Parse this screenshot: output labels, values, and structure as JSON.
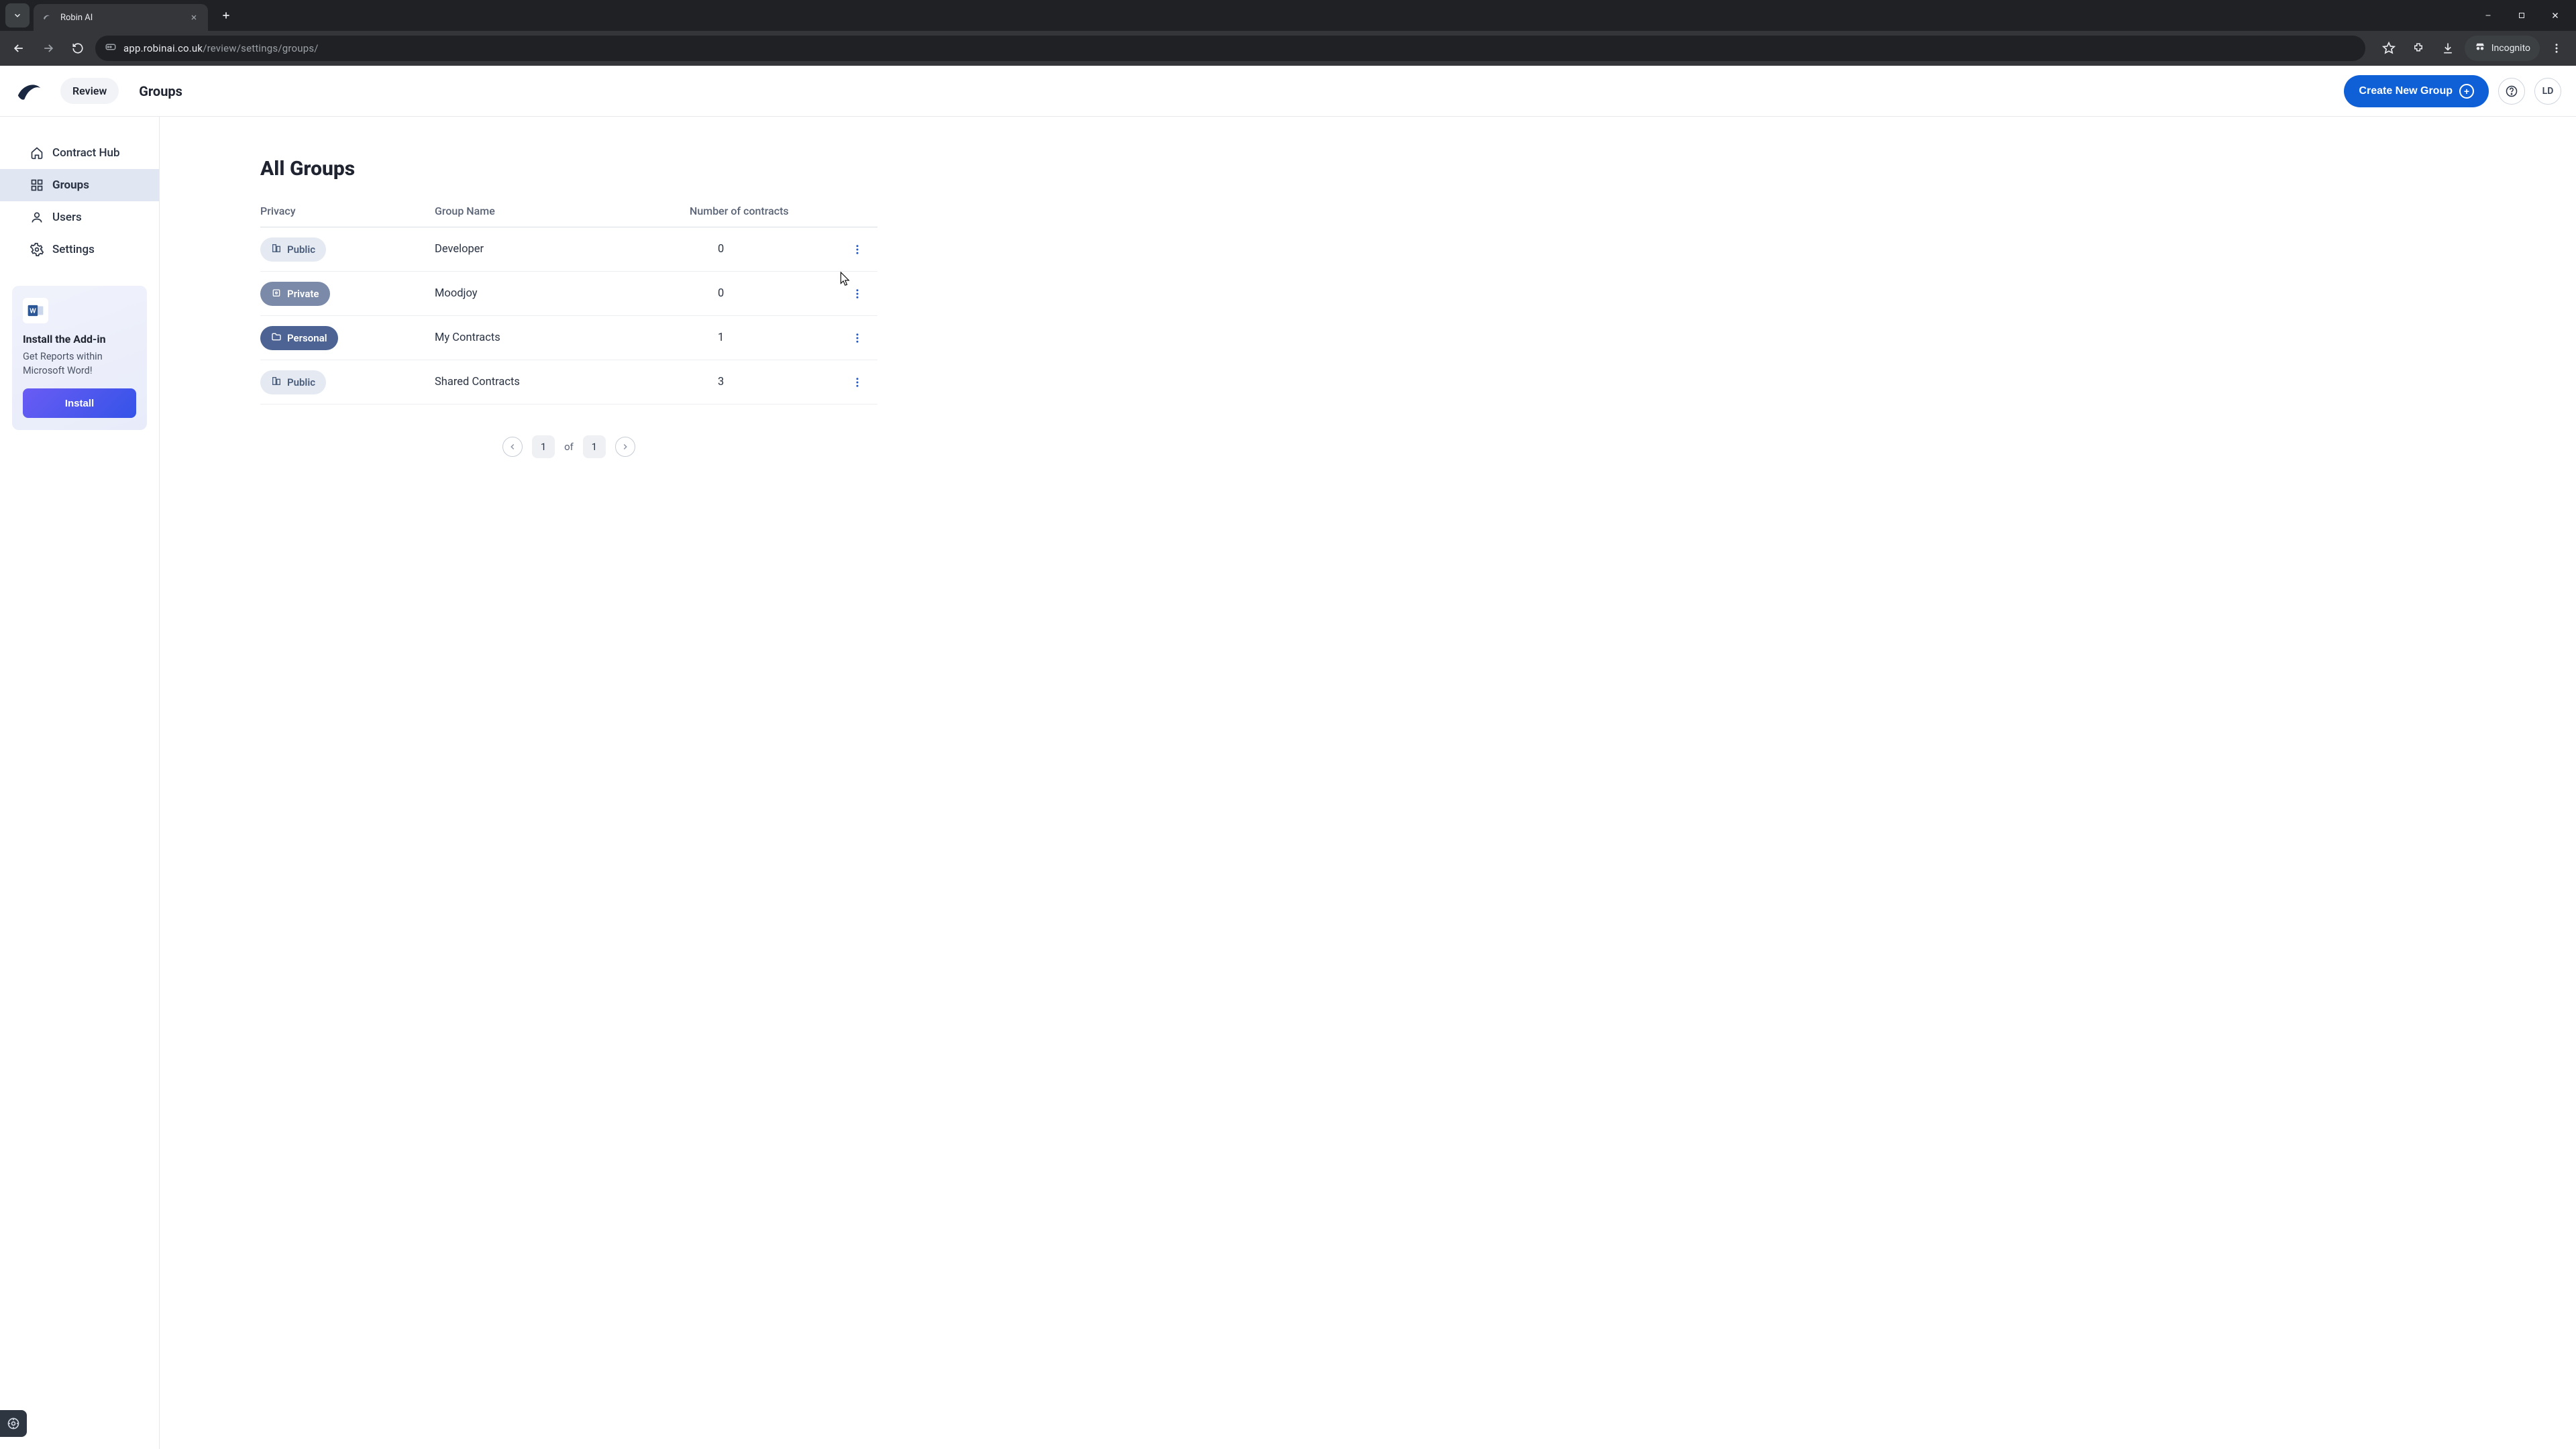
{
  "browser": {
    "tab_title": "Robin AI",
    "url_host": "app.robinai.co.uk",
    "url_path": "/review/settings/groups/",
    "incognito_label": "Incognito"
  },
  "header": {
    "review_label": "Review",
    "page_title": "Groups",
    "create_button": "Create New Group",
    "avatar_initials": "LD"
  },
  "sidebar": {
    "items": [
      {
        "label": "Contract Hub",
        "icon": "home",
        "active": false
      },
      {
        "label": "Groups",
        "icon": "grid",
        "active": true
      },
      {
        "label": "Users",
        "icon": "user",
        "active": false
      },
      {
        "label": "Settings",
        "icon": "gear",
        "active": false
      }
    ],
    "addin": {
      "title": "Install the Add-in",
      "subtitle": "Get Reports within Microsoft Word!",
      "button": "Install"
    }
  },
  "main": {
    "heading": "All Groups",
    "columns": {
      "privacy": "Privacy",
      "group_name": "Group Name",
      "contracts": "Number of contracts"
    },
    "rows": [
      {
        "privacy": "Public",
        "privacy_type": "public",
        "name": "Developer",
        "count": "0"
      },
      {
        "privacy": "Private",
        "privacy_type": "private",
        "name": "Moodjoy",
        "count": "0"
      },
      {
        "privacy": "Personal",
        "privacy_type": "personal",
        "name": "My Contracts",
        "count": "1"
      },
      {
        "privacy": "Public",
        "privacy_type": "public",
        "name": "Shared Contracts",
        "count": "3"
      }
    ],
    "pagination": {
      "current": "1",
      "of_label": "of",
      "total": "1"
    }
  }
}
